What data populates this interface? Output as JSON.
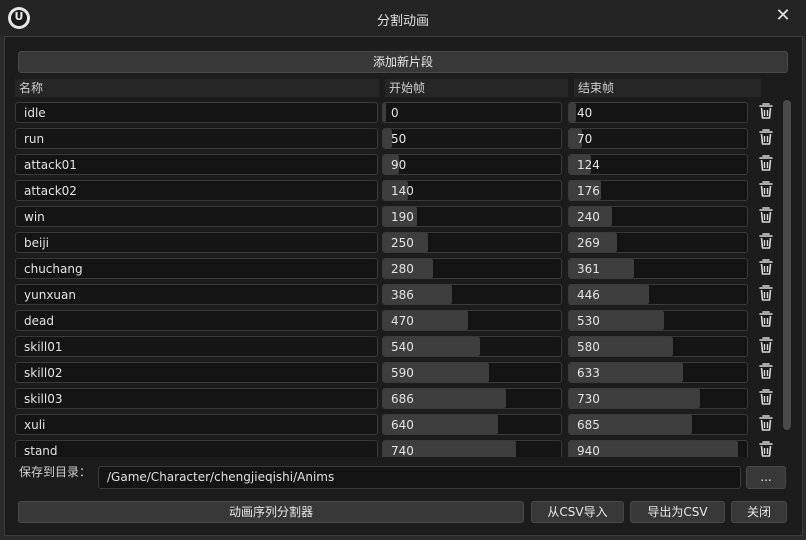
{
  "window": {
    "title": "分割动画"
  },
  "toolbar": {
    "add_segment_label": "添加新片段"
  },
  "columns": {
    "name": "名称",
    "start": "开始帧",
    "end": "结束帧"
  },
  "segments": [
    {
      "name": "idle",
      "start": "0",
      "end": "40"
    },
    {
      "name": "run",
      "start": "50",
      "end": "70"
    },
    {
      "name": "attack01",
      "start": "90",
      "end": "124"
    },
    {
      "name": "attack02",
      "start": "140",
      "end": "176"
    },
    {
      "name": "win",
      "start": "190",
      "end": "240"
    },
    {
      "name": "beiji",
      "start": "250",
      "end": "269"
    },
    {
      "name": "chuchang",
      "start": "280",
      "end": "361"
    },
    {
      "name": "yunxuan",
      "start": "386",
      "end": "446"
    },
    {
      "name": "dead",
      "start": "470",
      "end": "530"
    },
    {
      "name": "skill01",
      "start": "540",
      "end": "580"
    },
    {
      "name": "skill02",
      "start": "590",
      "end": "633"
    },
    {
      "name": "skill03",
      "start": "686",
      "end": "730"
    },
    {
      "name": "xuli",
      "start": "640",
      "end": "685"
    },
    {
      "name": "stand",
      "start": "740",
      "end": "940"
    }
  ],
  "save": {
    "label": "保存到目录：",
    "path": "/Game/Character/chengjieqishi/Anims",
    "browse_label": "..."
  },
  "footer": {
    "split_label": "动画序列分割器",
    "import_label": "从CSV导入",
    "export_label": "导出为CSV",
    "close_label": "关闭"
  },
  "icons": {
    "logo": "unreal-logo-icon",
    "close": "close-icon",
    "delete": "trash-icon"
  },
  "colors": {
    "background": "#1c1c1c",
    "field": "#141414",
    "slider_fill": "#3e3e3e",
    "button": "#383838"
  }
}
